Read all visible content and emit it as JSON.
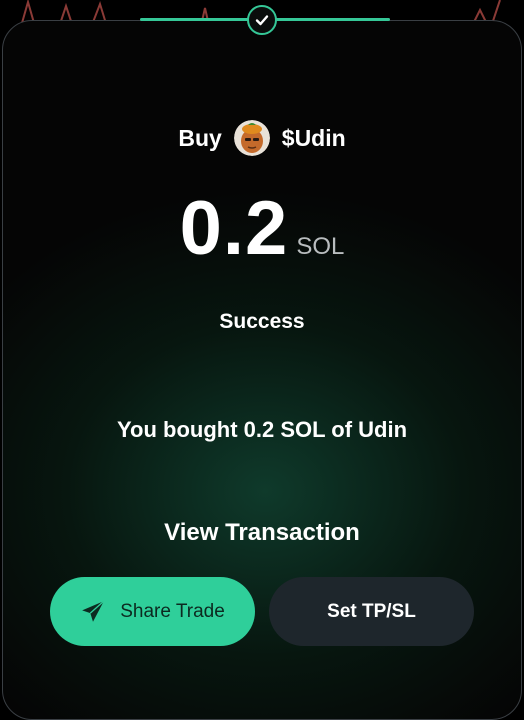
{
  "trade": {
    "action": "Buy",
    "token": "$Udin",
    "amount": "0.2",
    "unit": "SOL",
    "status": "Success",
    "message": "You bought 0.2 SOL of Udin"
  },
  "actions": {
    "view_transaction": "View Transaction",
    "share_trade": "Share Trade",
    "set_tpsl": "Set TP/SL"
  },
  "icons": {
    "status": "checkmark-icon",
    "share": "paper-plane-icon",
    "token": "token-avatar"
  },
  "colors": {
    "accent": "#2fcf9a",
    "chart_line": "#8a3a36",
    "secondary_button": "#1e262c"
  }
}
